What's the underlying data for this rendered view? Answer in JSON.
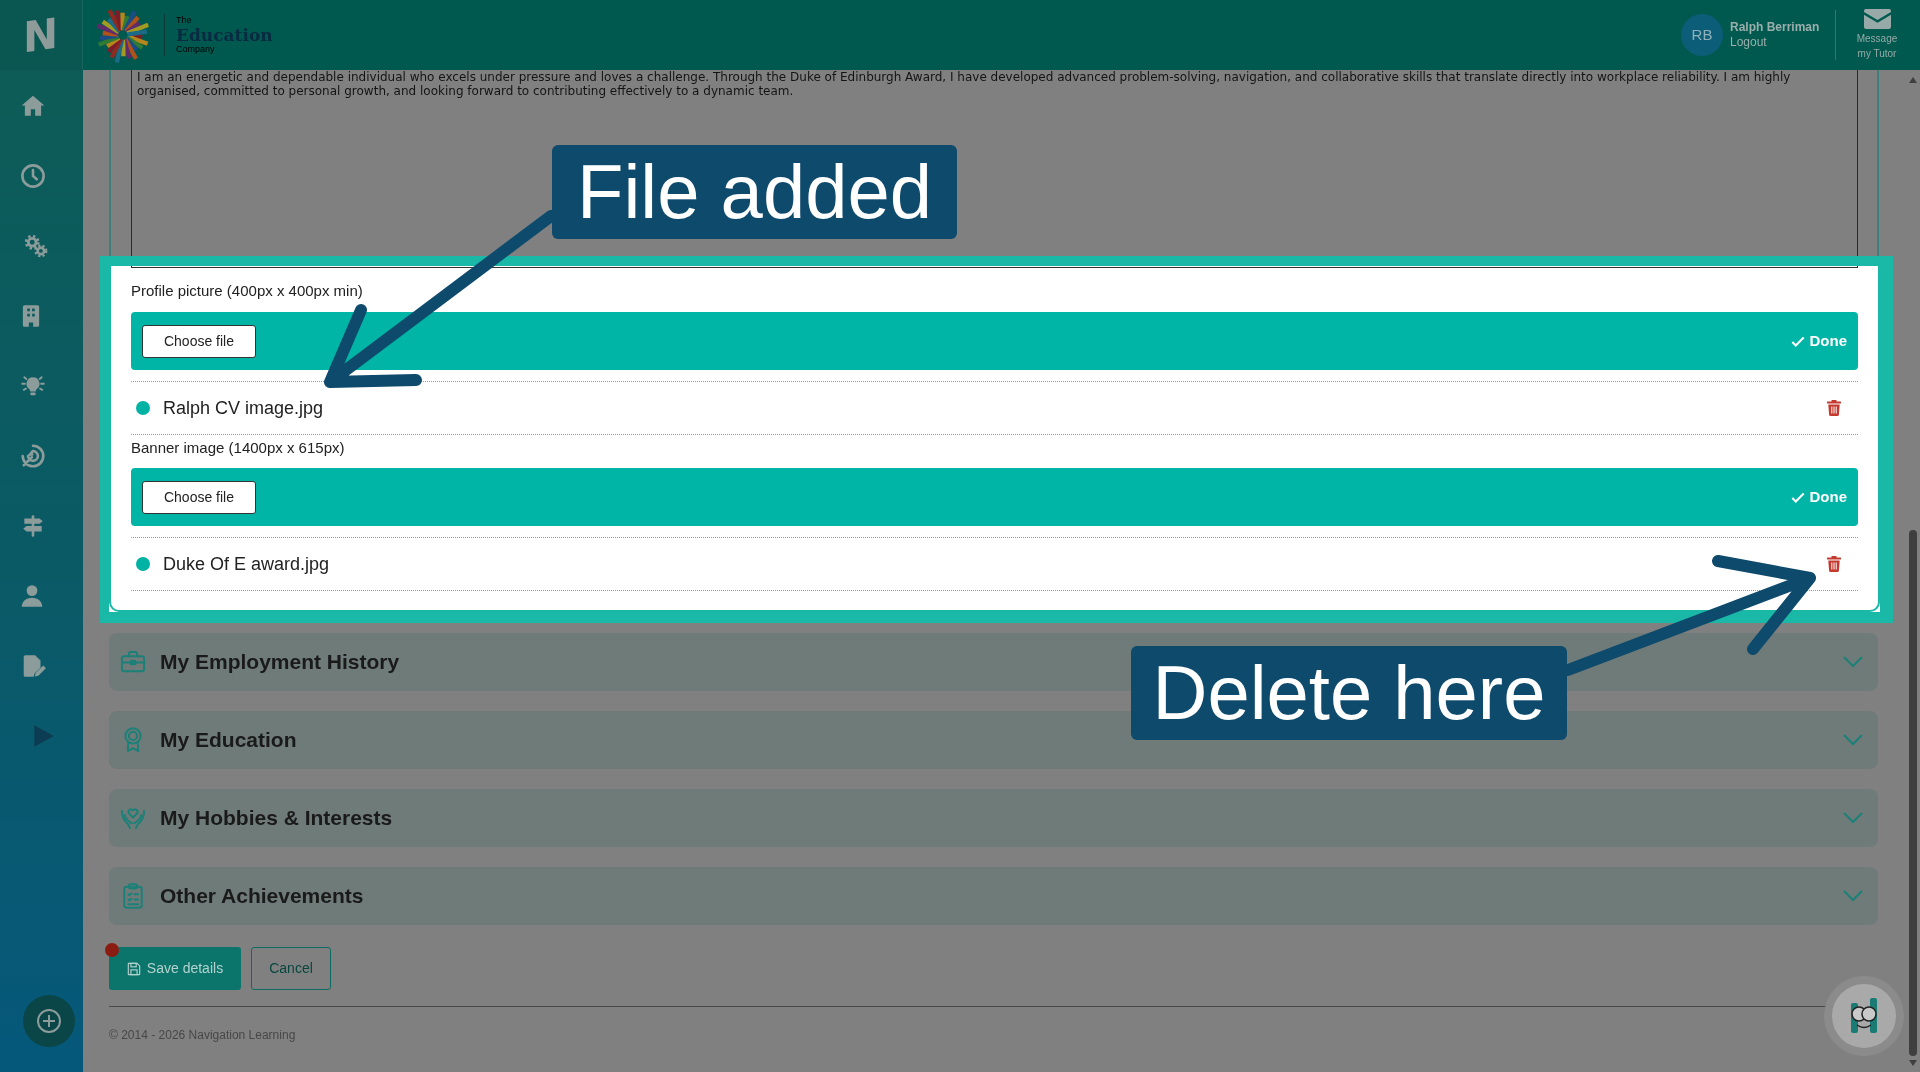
{
  "sidebar": {
    "logo": "N"
  },
  "header": {
    "brand": {
      "prefix": "The",
      "name": "Education",
      "suffix": "Company"
    },
    "user": {
      "initials": "RB",
      "name": "Ralph Berriman",
      "logout": "Logout"
    },
    "message_button": "Message my Tutor"
  },
  "personal_statement": {
    "text": "I am an energetic and dependable individual who excels under pressure and loves a challenge. Through the Duke of Edinburgh Award, I have developed advanced problem-solving, navigation, and collaborative skills that translate directly into workplace reliability. I am highly organised, committed to personal growth, and looking forward to contributing effectively to a dynamic team."
  },
  "uploads": [
    {
      "label": "Profile picture (400px x 400px min)",
      "button": "Choose file",
      "status": "Done",
      "files": [
        {
          "name": "Ralph CV image.jpg"
        }
      ]
    },
    {
      "label": "Banner image (1400px x 615px)",
      "button": "Choose file",
      "status": "Done",
      "files": [
        {
          "name": "Duke Of E award.jpg"
        }
      ]
    }
  ],
  "sections": [
    {
      "title": "My Employment History",
      "expanded": false
    },
    {
      "title": "My Education",
      "expanded": false
    },
    {
      "title": "My Hobbies & Interests",
      "expanded": false
    },
    {
      "title": "Other Achievements",
      "expanded": false
    }
  ],
  "actions": {
    "save": "Save details",
    "cancel": "Cancel",
    "unsaved_changes": true
  },
  "footer": "© 2014 - 2026 Navigation Learning",
  "callouts": [
    {
      "text": "File added"
    },
    {
      "text": "Delete here"
    }
  ]
}
